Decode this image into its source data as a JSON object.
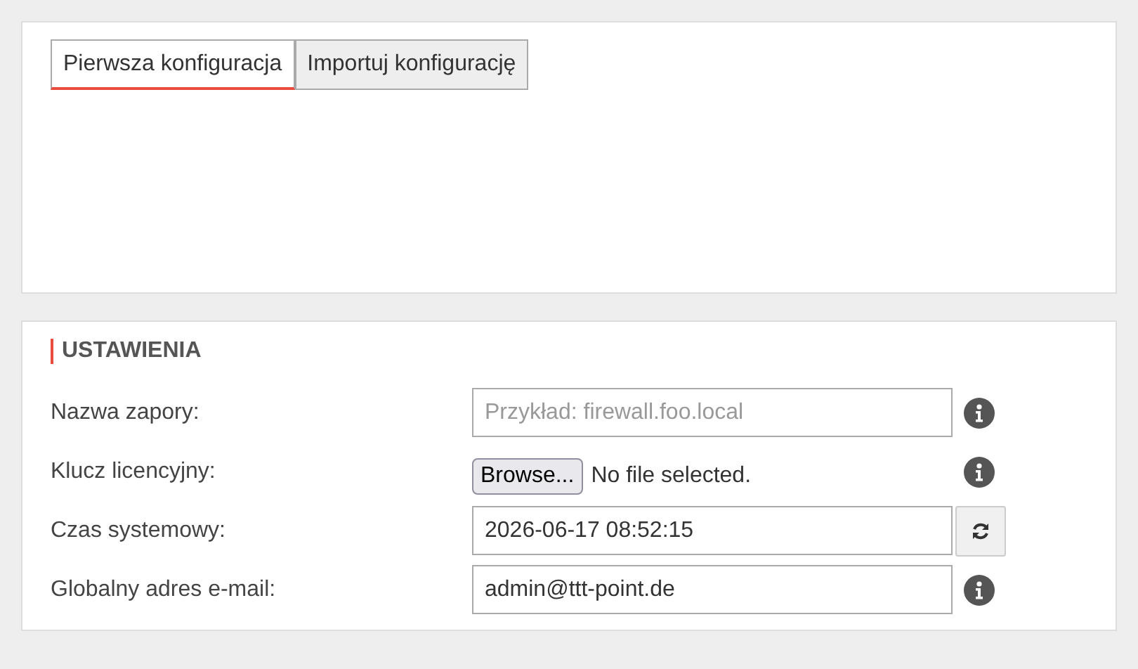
{
  "tabs": [
    {
      "label": "Pierwsza konfiguracja",
      "selected": true
    },
    {
      "label": "Importuj konfigurację",
      "selected": false
    }
  ],
  "settings": {
    "title": "USTAWIENIA",
    "rows": [
      {
        "kind": "text",
        "label": "Nazwa zapory:",
        "placeholder": "Przykład: firewall.foo.local",
        "action": {
          "kind": "info"
        }
      },
      {
        "kind": "file",
        "label": "Klucz licencyjny:",
        "button": "Browse...",
        "status": "No file selected.",
        "action": {
          "kind": "info"
        }
      },
      {
        "kind": "text",
        "label": "Czas systemowy:",
        "value": "2026-06-17 08:52:15",
        "action": {
          "kind": "refresh"
        }
      },
      {
        "kind": "text",
        "label": "Globalny adres e-mail:",
        "value": "admin@ttt-point.de",
        "action": {
          "kind": "info"
        }
      }
    ]
  }
}
